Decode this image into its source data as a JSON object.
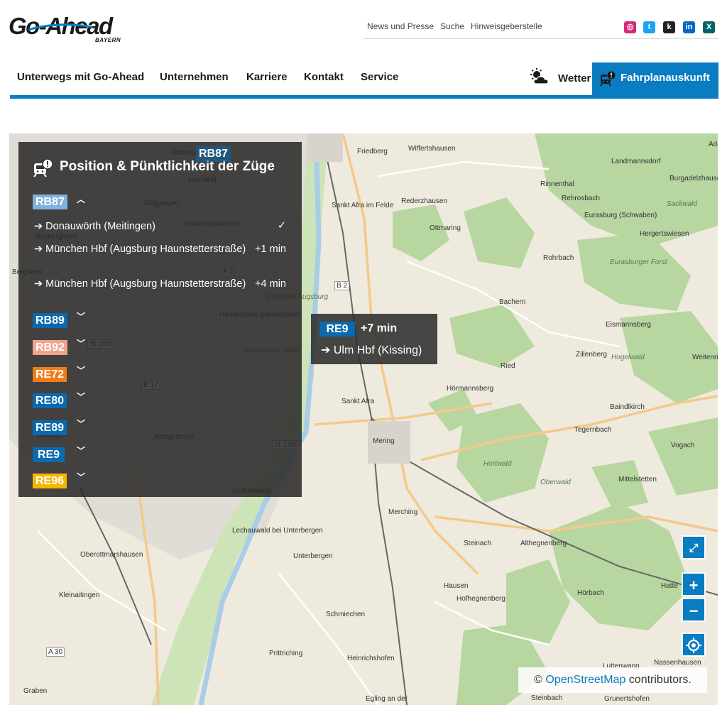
{
  "brand": {
    "logo_text": "Go-Ahead",
    "logo_sub": "BAYERN"
  },
  "topnav": [
    "News und Presse",
    "Suche",
    "Hinweisgeberstelle"
  ],
  "social": [
    {
      "name": "instagram",
      "color": "#d62976",
      "glyph": "◎"
    },
    {
      "name": "twitter",
      "color": "#1da1f2",
      "glyph": "t"
    },
    {
      "name": "kununu",
      "color": "#222222",
      "glyph": "k"
    },
    {
      "name": "linkedin",
      "color": "#0a66c2",
      "glyph": "in"
    },
    {
      "name": "xing",
      "color": "#026466",
      "glyph": "X"
    }
  ],
  "mainnav": [
    "Unterwegs mit Go-Ahead",
    "Unternehmen",
    "Karriere",
    "Kontakt",
    "Service"
  ],
  "weather_label": "Wetter",
  "fahrplan_label": "Fahrplanauskunft",
  "panel": {
    "title": "Position & Pünktlichkeit der Züge",
    "lines": [
      {
        "label": "RB87",
        "color": "#7fb2dd",
        "expanded": true
      },
      {
        "label": "RB89",
        "color": "#0a6aad",
        "expanded": false
      },
      {
        "label": "RB92",
        "color": "#f0a48c",
        "expanded": false
      },
      {
        "label": "RE72",
        "color": "#ee7e1a",
        "expanded": false
      },
      {
        "label": "RE80",
        "color": "#0a6aad",
        "expanded": false
      },
      {
        "label": "RE89",
        "color": "#0a6aad",
        "expanded": false
      },
      {
        "label": "RE9",
        "color": "#0a6aad",
        "expanded": false
      },
      {
        "label": "RE96",
        "color": "#f5b800",
        "expanded": false
      }
    ],
    "rb87_trains": [
      {
        "dest": "➔ Donauwörth (Meitingen)",
        "status": "✓"
      },
      {
        "dest": "➔ München Hbf (Augsburg Haunstetterstraße)",
        "status": "+1 min"
      },
      {
        "dest": "➔ München Hbf (Augsburg Haunstetterstraße)",
        "status": "+4 min"
      }
    ]
  },
  "popup": {
    "line": "RE9",
    "line_color": "#0a6aad",
    "delay": "+7 min",
    "dest": "➔ Ulm Hbf (Kissing)"
  },
  "map_marker": "RB87",
  "attribution": {
    "prefix": "©",
    "link": "OpenStreetMap",
    "suffix": "contributors."
  },
  "map_places": [
    "Friedberg",
    "Wiffertshausen",
    "Landmannsdorf",
    "Burgadelzhausen",
    "Ade",
    "Rinnenthal",
    "Rehrosbach",
    "Rederzhausen",
    "Sankt Afra im Felde",
    "Ottmaring",
    "Eurasburg (Schwaben)",
    "Hergertswiesen",
    "Rohrbach",
    "Bachern",
    "Eismannsberg",
    "Zillenberg",
    "Weitenried",
    "Ried",
    "Hörmannsberg",
    "Sankt Afra",
    "Baindlkirch",
    "Tegernbach",
    "Mering",
    "Vogach",
    "Mittelstetten",
    "Merching",
    "Steinach",
    "Althegnenberg",
    "Unterbergen",
    "Hausen",
    "Hofhegnenberg",
    "Hörbach",
    "Hatte",
    "Schmiechen",
    "Prittriching",
    "Heinrichshofen",
    "Egling an der",
    "Steinbach",
    "Grunertshofen",
    "Luttenwang",
    "Nassenhausen",
    "Graben",
    "Kleinaitingen",
    "Oberottmarshausen",
    "Königsbrunn",
    "Haunstetten Siebenbrunn",
    "Hochfeld",
    "Antonsviertel",
    "Göggingen",
    "Universitätsviertel",
    "Neubergheim",
    "Bergheim",
    "Bobingen",
    "Lechauwald",
    "Lechauwald bei Unterbergen"
  ],
  "map_labels": {
    "forests": [
      "Eurasburger Forst",
      "Sackwald",
      "Hogelwald",
      "Hortwald",
      "Oberwald",
      "Stadtwald Augsburg",
      "Haunstetter Wald"
    ],
    "roads": [
      "B 2",
      "B 17",
      "A 8",
      "A 30",
      "St 2035",
      "St 2380"
    ]
  }
}
